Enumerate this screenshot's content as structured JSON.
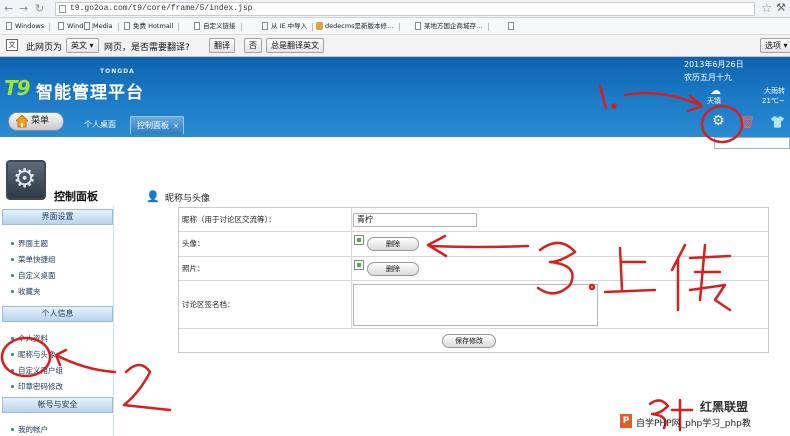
{
  "browser": {
    "url": "t9.go2oa.com/t9/core/frame/5/index.jsp",
    "bookmarks": [
      "Windows",
      "Windo",
      "Media",
      "免费 Hotmail",
      "自定义链接",
      "从 IE 中导入",
      "dedecms是新版本修…",
      "某地方国企商城存…"
    ]
  },
  "translate_bar": {
    "prefix": "此网页为",
    "language": "英文",
    "question": "网页，是否需要翻译?",
    "translate_btn": "翻译",
    "no_btn": "否",
    "always_btn": "总是翻译英文",
    "options_btn": "选项"
  },
  "header": {
    "logo_t9": "T9",
    "logo_name": "智能管理平台",
    "logo_sub": "TONGDA",
    "date": "2013年6月26日",
    "lunar": "农历五月十九",
    "weather": "大雨转",
    "city": "天镇",
    "temp": "21℃~",
    "menu_label": "菜单",
    "tabs": [
      {
        "label": "个人桌面"
      },
      {
        "label": "控制面板"
      }
    ],
    "tab_close": "×"
  },
  "sidebar": {
    "title": "控制面板",
    "sections": [
      {
        "label": "界面设置",
        "items": [
          "界面主题",
          "菜单快捷组",
          "自定义桌面",
          "收藏夹"
        ]
      },
      {
        "label": "个人信息",
        "items": [
          "个人资料",
          "昵称与头像",
          "自定义用户组",
          "印章密码修改"
        ]
      },
      {
        "label": "帐号与安全",
        "items": [
          "我的帐户"
        ]
      }
    ]
  },
  "content": {
    "title": "昵称与头像",
    "fields": {
      "nickname_label": "昵称（用于讨论区交流等）：",
      "nickname_value": "青柠",
      "avatar_label": "头像：",
      "photo_label": "照片：",
      "signature_label": "讨论区签名档：",
      "delete_btn": "删除",
      "save_btn": "保存修改"
    }
  },
  "annotations": {
    "note3": "3.上传",
    "note1": "1.",
    "note2": "2"
  },
  "watermark": {
    "text": "自学PHP网_php学习_php教",
    "logo": "红黑联盟",
    "p": "P"
  }
}
